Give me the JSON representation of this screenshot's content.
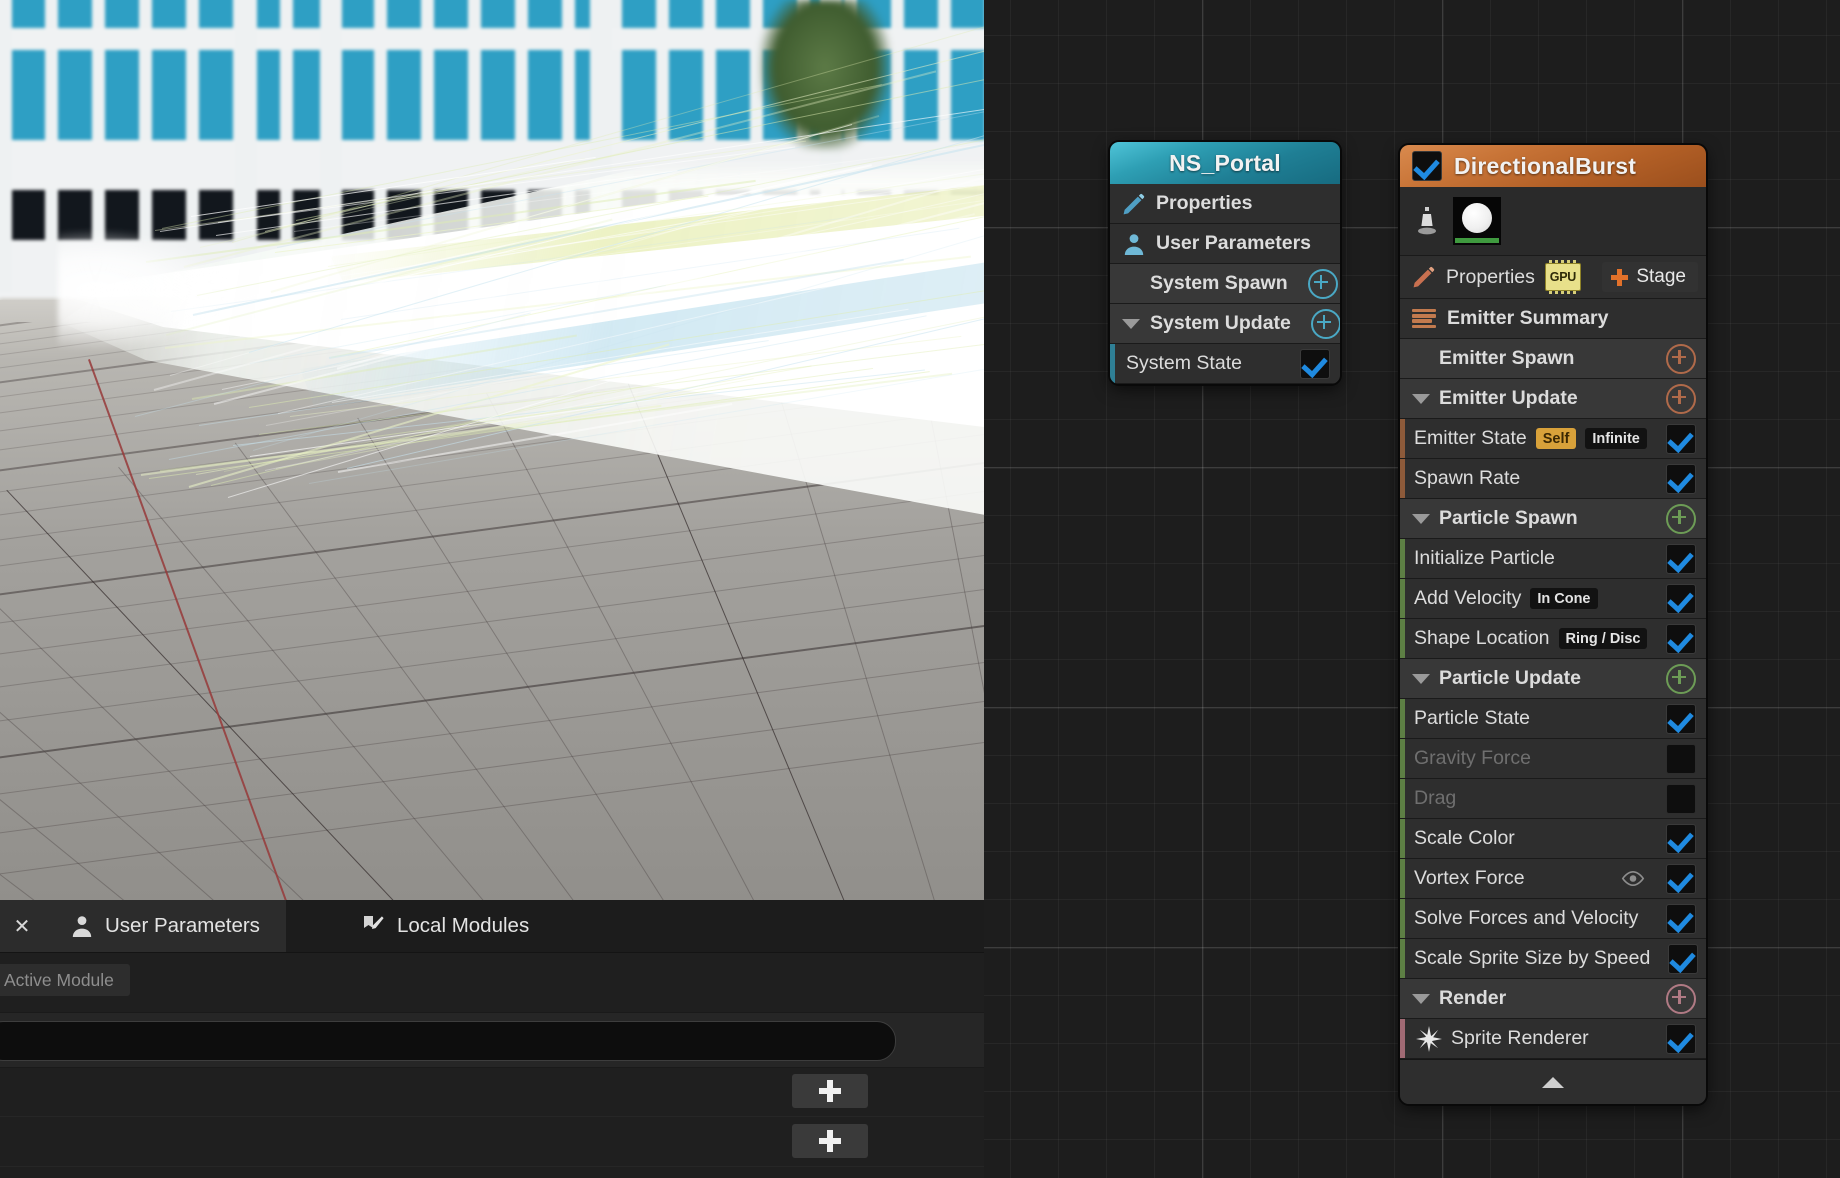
{
  "viewport": {
    "name": "niagara-preview-viewport",
    "description": "3D preview of particle system showing bright white directional beam over grid floor with office building backdrop"
  },
  "bottom_panel": {
    "close_label": "✕",
    "tabs": [
      {
        "label": "User Parameters",
        "icon": "person-icon",
        "active": true
      },
      {
        "label": "Local Modules",
        "icon": "modules-pencil-icon",
        "active": false
      }
    ],
    "section_pill": "Active Module",
    "search_placeholder": "",
    "search_value": "",
    "add_button_label": "+"
  },
  "system_node": {
    "title": "NS_Portal",
    "rows": [
      {
        "label": "Properties",
        "icon": "pencil-icon",
        "type": "item"
      },
      {
        "label": "User Parameters",
        "icon": "person-icon",
        "type": "item"
      },
      {
        "label": "System Spawn",
        "type": "section",
        "plus": true,
        "caret": false,
        "plus_color": "teal"
      },
      {
        "label": "System Update",
        "type": "section",
        "plus": true,
        "caret": true,
        "plus_color": "teal"
      },
      {
        "label": "System State",
        "type": "module",
        "checked": true,
        "stripe": "#2f7f95"
      }
    ]
  },
  "emitter_node": {
    "title": "DirectionalBurst",
    "enabled": true,
    "thumbnail_icon": "sprite-thumbnail",
    "localspace_icon": "local-space-icon",
    "properties_label": "Properties",
    "gpu_badge": "GPU",
    "stage_label": "Stage",
    "summary_label": "Emitter Summary",
    "rows": [
      {
        "label": "Emitter Spawn",
        "type": "section",
        "caret": false,
        "plus_color": "orange"
      },
      {
        "label": "Emitter Update",
        "type": "section",
        "caret": true,
        "plus_color": "orange"
      },
      {
        "label": "Emitter State",
        "type": "module",
        "checked": true,
        "enabled": true,
        "stripe": "#8d5a3a",
        "badges": [
          {
            "text": "Self",
            "style": "gold"
          },
          {
            "text": "Infinite",
            "style": "dark"
          }
        ]
      },
      {
        "label": "Spawn Rate",
        "type": "module",
        "checked": true,
        "enabled": true,
        "stripe": "#8d5a3a"
      },
      {
        "label": "Particle Spawn",
        "type": "section",
        "caret": true,
        "plus_color": "green"
      },
      {
        "label": "Initialize Particle",
        "type": "module",
        "checked": true,
        "enabled": true,
        "stripe": "#5d7f44"
      },
      {
        "label": "Add Velocity",
        "type": "module",
        "checked": true,
        "enabled": true,
        "stripe": "#5d7f44",
        "badges": [
          {
            "text": "In Cone",
            "style": "dark"
          }
        ]
      },
      {
        "label": "Shape Location",
        "type": "module",
        "checked": true,
        "enabled": true,
        "stripe": "#5d7f44",
        "badges": [
          {
            "text": "Ring / Disc",
            "style": "dark"
          }
        ]
      },
      {
        "label": "Particle Update",
        "type": "section",
        "caret": true,
        "plus_color": "green"
      },
      {
        "label": "Particle State",
        "type": "module",
        "checked": true,
        "enabled": true,
        "stripe": "#5d7f44"
      },
      {
        "label": "Gravity Force",
        "type": "module",
        "checked": false,
        "enabled": false,
        "stripe": "#5d7f44"
      },
      {
        "label": "Drag",
        "type": "module",
        "checked": false,
        "enabled": false,
        "stripe": "#5d7f44"
      },
      {
        "label": "Scale Color",
        "type": "module",
        "checked": true,
        "enabled": true,
        "stripe": "#5d7f44"
      },
      {
        "label": "Vortex Force",
        "type": "module",
        "checked": true,
        "enabled": true,
        "stripe": "#5d7f44",
        "eye": true
      },
      {
        "label": "Solve Forces and Velocity",
        "type": "module",
        "checked": true,
        "enabled": true,
        "stripe": "#5d7f44"
      },
      {
        "label": "Scale Sprite Size by Speed",
        "type": "module",
        "checked": true,
        "enabled": true,
        "stripe": "#5d7f44"
      },
      {
        "label": "Render",
        "type": "section",
        "caret": true,
        "plus_color": "rose"
      },
      {
        "label": "Sprite Renderer",
        "type": "module",
        "checked": true,
        "enabled": true,
        "stripe": "#a06a74",
        "icon": "starburst-icon"
      }
    ],
    "collapse_icon": "chevron-up-icon"
  },
  "colors": {
    "system_header": "#2e9fb4",
    "emitter_header": "#c87437",
    "checkbox_check": "#1f8ae0",
    "gold_badge": "#d8a13a",
    "gpu_badge": "#e8e08a",
    "stage_plus": "#e2712a"
  }
}
